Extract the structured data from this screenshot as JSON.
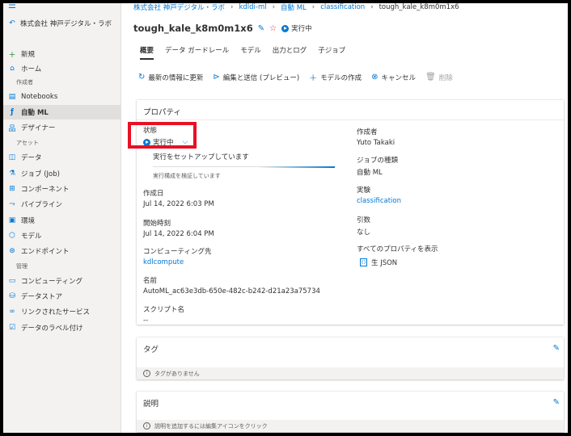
{
  "workspace": {
    "name": "株式会社 神戸デジタル・ラボ"
  },
  "sidebar": {
    "items_top": [
      {
        "label": "新規",
        "icon": "plus-icon"
      },
      {
        "label": "ホーム",
        "icon": "home-icon"
      }
    ],
    "section_author": "作成者",
    "items_author": [
      {
        "label": "Notebooks",
        "icon": "notebook-icon"
      },
      {
        "label": "自動 ML",
        "icon": "automl-icon"
      },
      {
        "label": "デザイナー",
        "icon": "designer-icon"
      }
    ],
    "section_assets": "アセット",
    "items_assets": [
      {
        "label": "データ",
        "icon": "data-icon"
      },
      {
        "label": "ジョブ (Job)",
        "icon": "job-icon"
      },
      {
        "label": "コンポーネント",
        "icon": "component-icon"
      },
      {
        "label": "パイプライン",
        "icon": "pipeline-icon"
      },
      {
        "label": "環境",
        "icon": "environment-icon"
      },
      {
        "label": "モデル",
        "icon": "model-icon"
      },
      {
        "label": "エンドポイント",
        "icon": "endpoint-icon"
      }
    ],
    "section_manage": "管理",
    "items_manage": [
      {
        "label": "コンピューティング",
        "icon": "compute-icon"
      },
      {
        "label": "データストア",
        "icon": "datastore-icon"
      },
      {
        "label": "リンクされたサービス",
        "icon": "link-icon"
      },
      {
        "label": "データのラベル付け",
        "icon": "label-icon"
      }
    ]
  },
  "breadcrumb": [
    "株式会社 神戸デジタル・ラボ",
    "kdldi-ml",
    "自動 ML",
    "classification",
    "tough_kale_k8m0m1x6"
  ],
  "run": {
    "name": "tough_kale_k8m0m1x6",
    "status": "実行中"
  },
  "tabs": [
    "概要",
    "データ ガードレール",
    "モデル",
    "出力とログ",
    "子ジョブ"
  ],
  "toolbar": {
    "refresh": "最新の情報に更新",
    "edit_submit": "編集と送信 (プレビュー)",
    "create_model": "モデルの作成",
    "cancel": "キャンセル",
    "delete": "削除"
  },
  "properties": {
    "title": "プロパティ",
    "status_label": "状態",
    "status_value": "実行中",
    "progress_text": "実行をセットアップしています",
    "progress_sub": "実行構成を検証しています",
    "created_label": "作成日",
    "created_value": "Jul 14, 2022 6:03 PM",
    "start_label": "開始時刻",
    "start_value": "Jul 14, 2022 6:04 PM",
    "compute_label": "コンピューティング先",
    "compute_value": "kdlcompute",
    "name_label": "名前",
    "name_value": "AutoML_ac63e3db-650e-482c-b242-d21a23a75734",
    "script_label": "スクリプト名",
    "script_value": "--",
    "author_label": "作成者",
    "author_value": "Yuto Takaki",
    "jobtype_label": "ジョブの種類",
    "jobtype_value": "自動 ML",
    "experiment_label": "実験",
    "experiment_value": "classification",
    "args_label": "引数",
    "args_value": "なし",
    "all_props_label": "すべてのプロパティを表示",
    "raw_json": "生 JSON"
  },
  "tags_card": {
    "title": "タグ",
    "empty": "タグがありません"
  },
  "description_card": {
    "title": "説明",
    "hint": "説明を追加するには編集アイコンをクリック"
  },
  "colors": {
    "accent": "#0078d4",
    "highlight": "#e81123"
  }
}
